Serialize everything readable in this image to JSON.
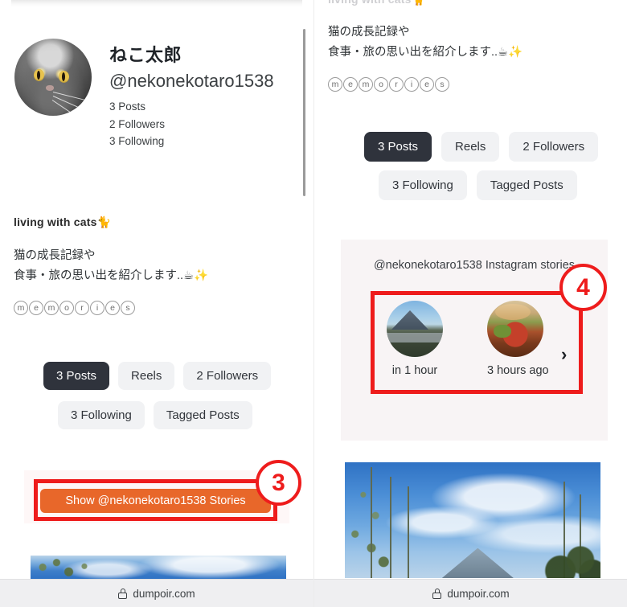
{
  "page": {
    "domain_label": "dumpoir.com",
    "accent_orange": "#e8672a",
    "annotation_red": "#ee1c1c",
    "pill_active_bg": "#2f333c",
    "pill_bg": "#f1f2f4"
  },
  "profile": {
    "display_name": "ねこ太郎",
    "handle": "@nekonekotaro1538",
    "stats": [
      {
        "label": "3 Posts"
      },
      {
        "label": "2 Followers"
      },
      {
        "label": "3 Following"
      }
    ],
    "bio_title": "living with cats🐈",
    "bio_lines": [
      "猫の成長記録や",
      "食事・旅の思い出を紹介します..☕✨"
    ],
    "memories_word": "memories"
  },
  "tabs": {
    "row1": [
      {
        "label": "3 Posts",
        "active": true
      },
      {
        "label": "Reels",
        "active": false
      },
      {
        "label": "2 Followers",
        "active": false
      }
    ],
    "row2": [
      {
        "label": "3 Following",
        "active": false
      },
      {
        "label": "Tagged Posts",
        "active": false
      }
    ]
  },
  "stories_button": {
    "label": "Show @nekonekotaro1538 Stories"
  },
  "stories_card": {
    "title": "@nekonekotaro1538 Instagram stories",
    "items": [
      {
        "time_label": "in 1 hour",
        "thumb": "mountain-lodge-photo"
      },
      {
        "time_label": "3 hours ago",
        "thumb": "food-bowl-photo"
      }
    ],
    "next_arrow": "›"
  },
  "annotations": [
    {
      "number": "3",
      "targets": "stories-button"
    },
    {
      "number": "4",
      "targets": "stories-thumbnails"
    }
  ],
  "icons": {
    "lock": "lock-icon",
    "chevron_right": "chevron-right-icon"
  }
}
